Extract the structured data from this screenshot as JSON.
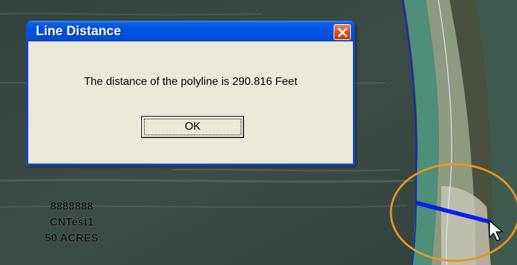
{
  "dialog": {
    "title": "Line Distance",
    "message": "The distance of the polyline is 290.816 Feet",
    "ok_label": "OK"
  },
  "parcel": {
    "id": "8888888",
    "name": "CNTest1",
    "area": "50 ACRES"
  },
  "colors": {
    "title_bar": "#0053e0",
    "dialog_bg": "#ece9d8",
    "measure_line": "#0a1eea",
    "highlight_circle": "#e8961e",
    "parcel_boundary": "#1a1ad8"
  },
  "icons": {
    "close": "close-icon",
    "cursor": "mouse-pointer-icon"
  }
}
